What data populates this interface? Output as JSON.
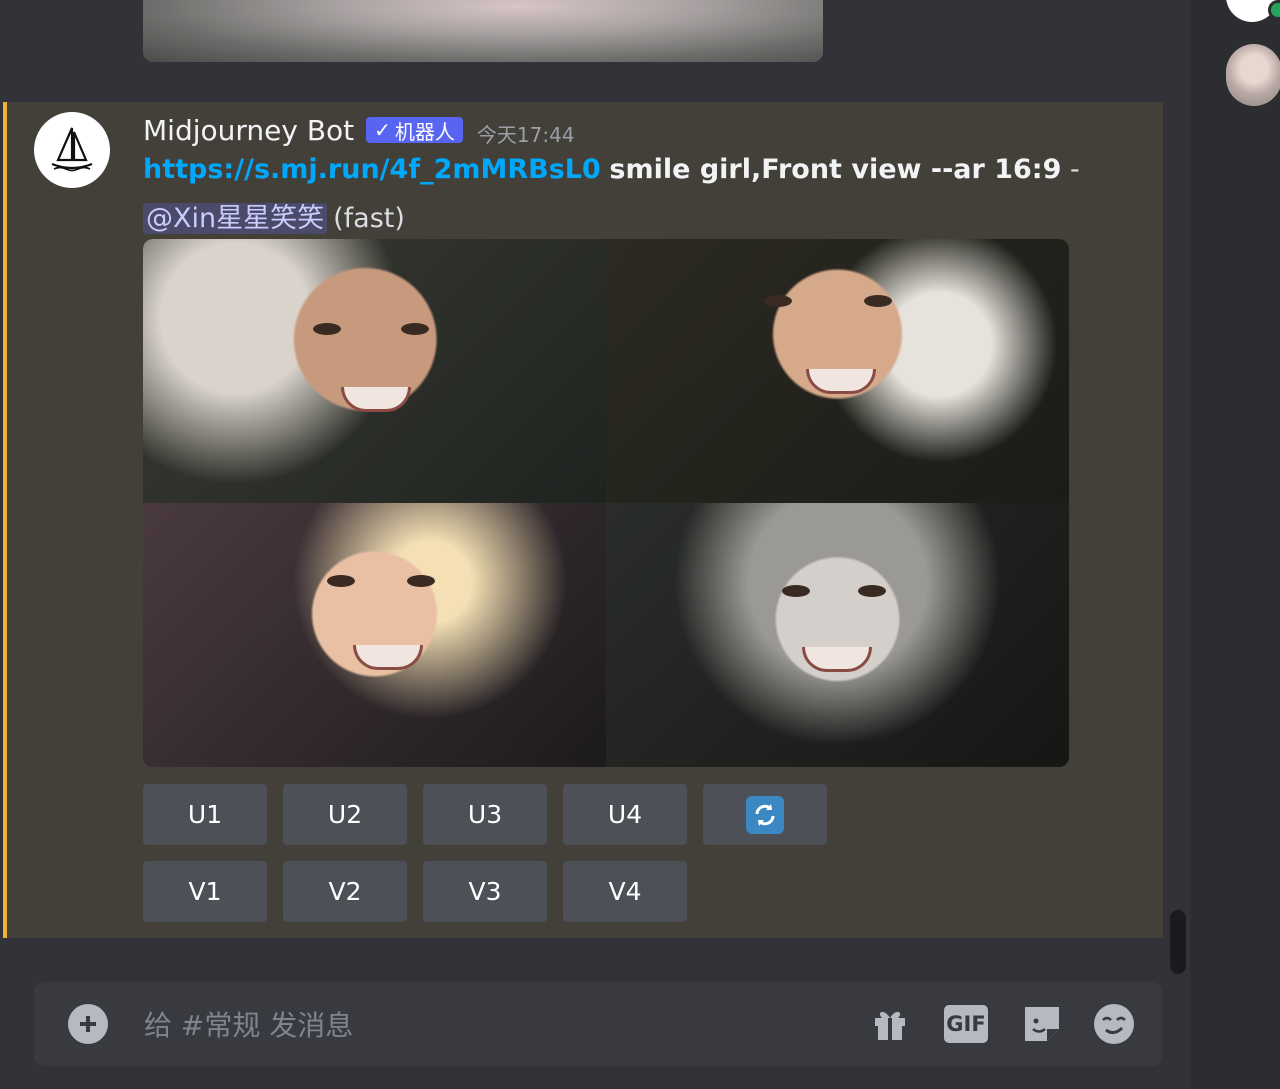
{
  "message": {
    "author": "Midjourney Bot",
    "bot_tag": "机器人",
    "bot_check": "✓",
    "timestamp": "今天17:44",
    "link": "https://s.mj.run/4f_2mMRBsL0",
    "prompt": "smile girl,Front view --ar 16:9",
    "separator": "-",
    "mention": "@Xin星星笑笑",
    "mode": "(fast)",
    "accent_color": "#f0b232",
    "images": [
      {
        "name": "grid-image-1"
      },
      {
        "name": "grid-image-2"
      },
      {
        "name": "grid-image-3"
      },
      {
        "name": "grid-image-4"
      }
    ]
  },
  "buttons": {
    "upscale": [
      "U1",
      "U2",
      "U3",
      "U4"
    ],
    "variation": [
      "V1",
      "V2",
      "V3",
      "V4"
    ],
    "reroll_icon": "refresh-icon"
  },
  "composer": {
    "placeholder": "给 #常规 发消息",
    "gif_label": "GIF",
    "icons": [
      "plus-icon",
      "gift-icon",
      "gif-icon",
      "sticker-icon",
      "emoji-icon"
    ]
  },
  "colors": {
    "background": "#313338",
    "highlight": "#433f39",
    "link": "#00a8fc",
    "bot_tag": "#5865f2",
    "button": "#4e5058",
    "online": "#23a55a"
  }
}
